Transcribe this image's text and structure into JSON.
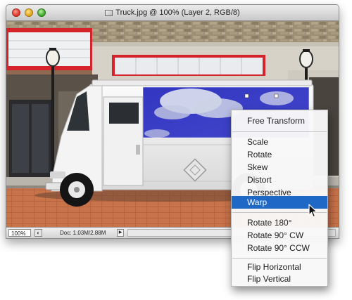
{
  "window": {
    "title": "Truck.jpg @ 100% (Layer 2, RGB/8)"
  },
  "icons": {
    "close": "close-button",
    "minimize": "minimize-button",
    "zoom": "zoom-button",
    "document": "document-icon",
    "cursor": "arrow-cursor-icon"
  },
  "statusbar": {
    "zoom": "100%",
    "doc_info": "Doc: 1.03M/2.88M",
    "popup_arrow": "▶"
  },
  "menu": {
    "items": [
      "Free Transform",
      "Scale",
      "Rotate",
      "Skew",
      "Distort",
      "Perspective",
      "Warp",
      "Rotate 180°",
      "Rotate 90° CW",
      "Rotate 90° CCW",
      "Flip Horizontal",
      "Flip Vertical"
    ],
    "highlighted": "Warp"
  },
  "colors": {
    "menu_highlight": "#1f68c6",
    "building_trim_red": "#d4232a",
    "sky_panel_blue": "#3a3dc4",
    "street_brick": "#c87349"
  }
}
